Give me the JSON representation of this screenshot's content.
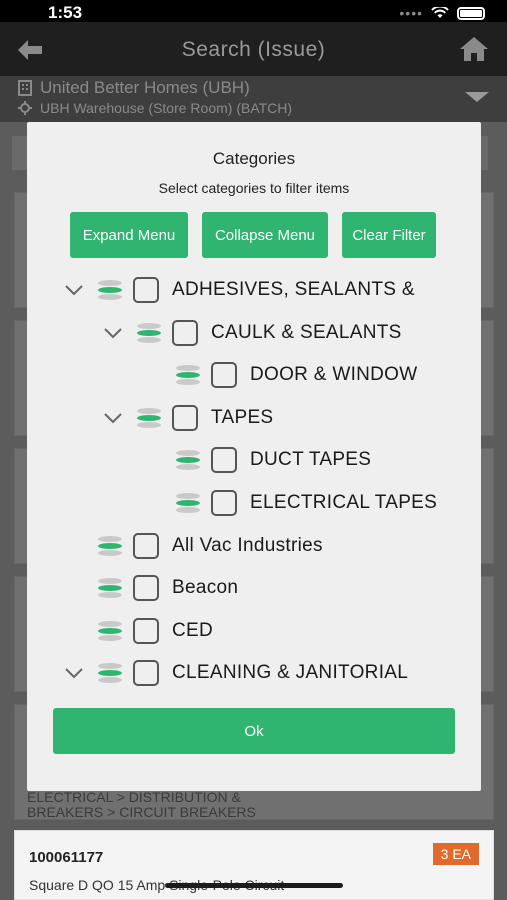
{
  "status_bar": {
    "time": "1:53"
  },
  "header": {
    "title": "Search  (Issue)"
  },
  "location": {
    "company": "United Better Homes (UBH)",
    "warehouse": "UBH Warehouse (Store Room)  (BATCH)"
  },
  "background": {
    "partial_path": "ELECTRICAL > DISTRIBUTION &",
    "partial_path2": "BREAKERS > CIRCUIT BREAKERS",
    "item": {
      "number": "100061177",
      "description": "Square D QO 15 Amp Single-Pole Circuit",
      "qty": "3 EA"
    }
  },
  "modal": {
    "title": "Categories",
    "subtitle": "Select categories to filter items",
    "buttons": {
      "expand": "Expand Menu",
      "collapse": "Collapse Menu",
      "clear": "Clear Filter"
    },
    "ok_label": "Ok",
    "tree": [
      {
        "label": "ADHESIVES, SEALANTS &",
        "level": 0,
        "expandable": true
      },
      {
        "label": "CAULK & SEALANTS",
        "level": 1,
        "expandable": true
      },
      {
        "label": "DOOR & WINDOW",
        "level": 2,
        "expandable": false
      },
      {
        "label": "TAPES",
        "level": 1,
        "expandable": true
      },
      {
        "label": "DUCT TAPES",
        "level": 2,
        "expandable": false
      },
      {
        "label": "ELECTRICAL TAPES",
        "level": 2,
        "expandable": false
      },
      {
        "label": "All Vac Industries",
        "level": 0,
        "expandable": false
      },
      {
        "label": "Beacon",
        "level": 0,
        "expandable": false
      },
      {
        "label": "CED",
        "level": 0,
        "expandable": false
      },
      {
        "label": "CLEANING & JANITORIAL",
        "level": 0,
        "expandable": true
      }
    ]
  },
  "colors": {
    "accent_green": "#2fb570",
    "badge_orange": "#e06a2b"
  },
  "icons": [
    "back-arrow-icon",
    "home-icon",
    "building-icon",
    "location-icon",
    "chevron-down-icon",
    "database-icon",
    "checkbox-icon",
    "wifi-icon",
    "battery-icon"
  ]
}
